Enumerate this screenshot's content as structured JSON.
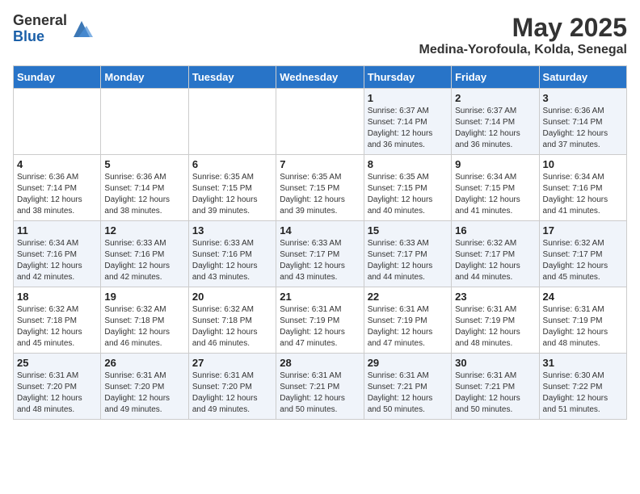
{
  "logo": {
    "general": "General",
    "blue": "Blue"
  },
  "header": {
    "month": "May 2025",
    "location": "Medina-Yorofoula, Kolda, Senegal"
  },
  "days_of_week": [
    "Sunday",
    "Monday",
    "Tuesday",
    "Wednesday",
    "Thursday",
    "Friday",
    "Saturday"
  ],
  "weeks": [
    [
      {
        "day": "",
        "info": ""
      },
      {
        "day": "",
        "info": ""
      },
      {
        "day": "",
        "info": ""
      },
      {
        "day": "",
        "info": ""
      },
      {
        "day": "1",
        "info": "Sunrise: 6:37 AM\nSunset: 7:14 PM\nDaylight: 12 hours and 36 minutes."
      },
      {
        "day": "2",
        "info": "Sunrise: 6:37 AM\nSunset: 7:14 PM\nDaylight: 12 hours and 36 minutes."
      },
      {
        "day": "3",
        "info": "Sunrise: 6:36 AM\nSunset: 7:14 PM\nDaylight: 12 hours and 37 minutes."
      }
    ],
    [
      {
        "day": "4",
        "info": "Sunrise: 6:36 AM\nSunset: 7:14 PM\nDaylight: 12 hours and 38 minutes."
      },
      {
        "day": "5",
        "info": "Sunrise: 6:36 AM\nSunset: 7:14 PM\nDaylight: 12 hours and 38 minutes."
      },
      {
        "day": "6",
        "info": "Sunrise: 6:35 AM\nSunset: 7:15 PM\nDaylight: 12 hours and 39 minutes."
      },
      {
        "day": "7",
        "info": "Sunrise: 6:35 AM\nSunset: 7:15 PM\nDaylight: 12 hours and 39 minutes."
      },
      {
        "day": "8",
        "info": "Sunrise: 6:35 AM\nSunset: 7:15 PM\nDaylight: 12 hours and 40 minutes."
      },
      {
        "day": "9",
        "info": "Sunrise: 6:34 AM\nSunset: 7:15 PM\nDaylight: 12 hours and 41 minutes."
      },
      {
        "day": "10",
        "info": "Sunrise: 6:34 AM\nSunset: 7:16 PM\nDaylight: 12 hours and 41 minutes."
      }
    ],
    [
      {
        "day": "11",
        "info": "Sunrise: 6:34 AM\nSunset: 7:16 PM\nDaylight: 12 hours and 42 minutes."
      },
      {
        "day": "12",
        "info": "Sunrise: 6:33 AM\nSunset: 7:16 PM\nDaylight: 12 hours and 42 minutes."
      },
      {
        "day": "13",
        "info": "Sunrise: 6:33 AM\nSunset: 7:16 PM\nDaylight: 12 hours and 43 minutes."
      },
      {
        "day": "14",
        "info": "Sunrise: 6:33 AM\nSunset: 7:17 PM\nDaylight: 12 hours and 43 minutes."
      },
      {
        "day": "15",
        "info": "Sunrise: 6:33 AM\nSunset: 7:17 PM\nDaylight: 12 hours and 44 minutes."
      },
      {
        "day": "16",
        "info": "Sunrise: 6:32 AM\nSunset: 7:17 PM\nDaylight: 12 hours and 44 minutes."
      },
      {
        "day": "17",
        "info": "Sunrise: 6:32 AM\nSunset: 7:17 PM\nDaylight: 12 hours and 45 minutes."
      }
    ],
    [
      {
        "day": "18",
        "info": "Sunrise: 6:32 AM\nSunset: 7:18 PM\nDaylight: 12 hours and 45 minutes."
      },
      {
        "day": "19",
        "info": "Sunrise: 6:32 AM\nSunset: 7:18 PM\nDaylight: 12 hours and 46 minutes."
      },
      {
        "day": "20",
        "info": "Sunrise: 6:32 AM\nSunset: 7:18 PM\nDaylight: 12 hours and 46 minutes."
      },
      {
        "day": "21",
        "info": "Sunrise: 6:31 AM\nSunset: 7:19 PM\nDaylight: 12 hours and 47 minutes."
      },
      {
        "day": "22",
        "info": "Sunrise: 6:31 AM\nSunset: 7:19 PM\nDaylight: 12 hours and 47 minutes."
      },
      {
        "day": "23",
        "info": "Sunrise: 6:31 AM\nSunset: 7:19 PM\nDaylight: 12 hours and 48 minutes."
      },
      {
        "day": "24",
        "info": "Sunrise: 6:31 AM\nSunset: 7:19 PM\nDaylight: 12 hours and 48 minutes."
      }
    ],
    [
      {
        "day": "25",
        "info": "Sunrise: 6:31 AM\nSunset: 7:20 PM\nDaylight: 12 hours and 48 minutes."
      },
      {
        "day": "26",
        "info": "Sunrise: 6:31 AM\nSunset: 7:20 PM\nDaylight: 12 hours and 49 minutes."
      },
      {
        "day": "27",
        "info": "Sunrise: 6:31 AM\nSunset: 7:20 PM\nDaylight: 12 hours and 49 minutes."
      },
      {
        "day": "28",
        "info": "Sunrise: 6:31 AM\nSunset: 7:21 PM\nDaylight: 12 hours and 50 minutes."
      },
      {
        "day": "29",
        "info": "Sunrise: 6:31 AM\nSunset: 7:21 PM\nDaylight: 12 hours and 50 minutes."
      },
      {
        "day": "30",
        "info": "Sunrise: 6:31 AM\nSunset: 7:21 PM\nDaylight: 12 hours and 50 minutes."
      },
      {
        "day": "31",
        "info": "Sunrise: 6:30 AM\nSunset: 7:22 PM\nDaylight: 12 hours and 51 minutes."
      }
    ]
  ]
}
